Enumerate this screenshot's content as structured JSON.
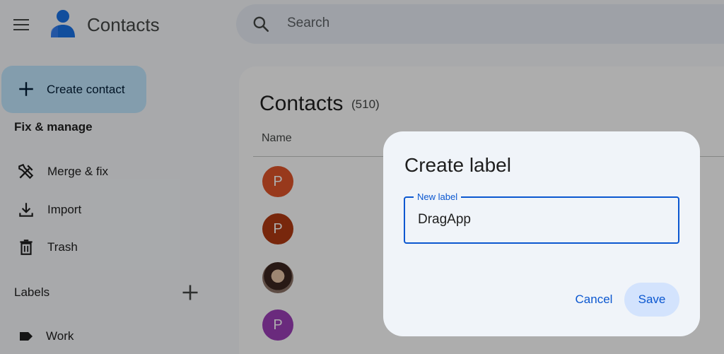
{
  "header": {
    "app_title": "Contacts",
    "search_placeholder": "Search"
  },
  "sidebar": {
    "create_label": "Create contact",
    "fix_manage_title": "Fix & manage",
    "items": [
      {
        "label": "Merge & fix",
        "icon": "merge-fix-icon"
      },
      {
        "label": "Import",
        "icon": "import-icon"
      },
      {
        "label": "Trash",
        "icon": "trash-icon"
      }
    ],
    "labels_title": "Labels",
    "labels": [
      {
        "label": "Work",
        "icon": "label-icon"
      }
    ]
  },
  "main": {
    "heading": "Contacts",
    "count": "(510)",
    "column_name": "Name",
    "rows": [
      {
        "initial": "P",
        "color": "#e0542a"
      },
      {
        "initial": "P",
        "color": "#b23a12"
      },
      {
        "initial": "",
        "photo": true
      },
      {
        "initial": "P",
        "color": "#9c3fb8"
      }
    ]
  },
  "dialog": {
    "title": "Create label",
    "field_label": "New label",
    "field_value": "DragApp",
    "cancel_label": "Cancel",
    "save_label": "Save"
  },
  "colors": {
    "accent": "#0b57d0",
    "create_button_bg": "#c2e7ff",
    "dialog_bg": "#f0f4f9",
    "save_button_bg": "#d3e3fd"
  }
}
